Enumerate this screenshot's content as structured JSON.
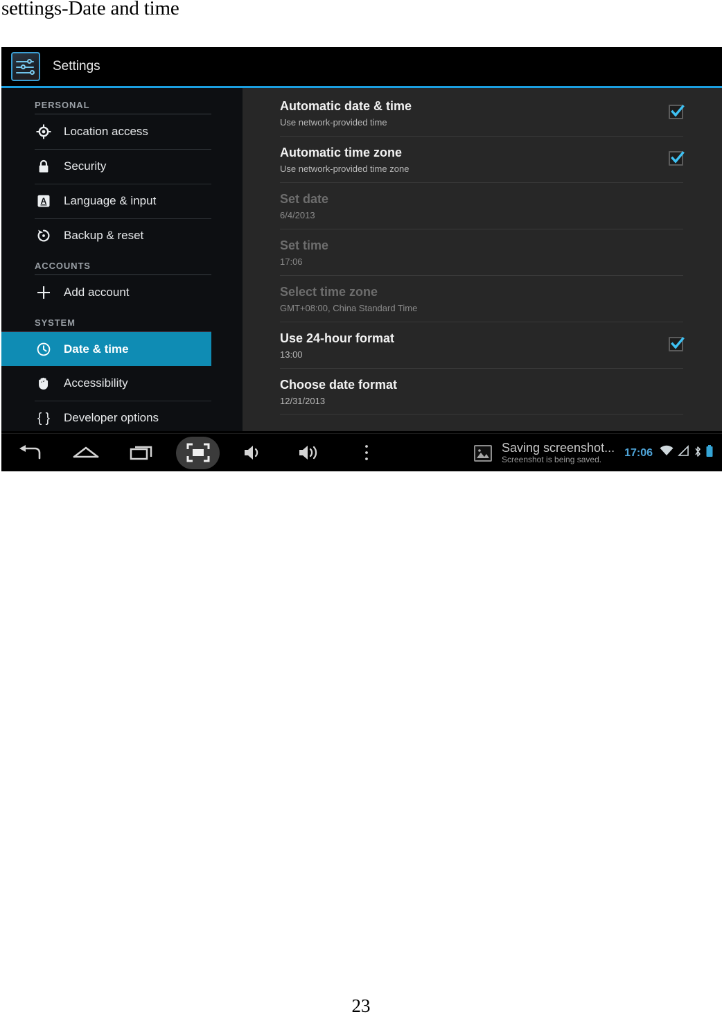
{
  "document": {
    "caption": "settings-Date and time",
    "page_number": "23"
  },
  "action_bar": {
    "title": "Settings",
    "icon": "settings-sliders-icon",
    "accent_color": "#1b9fe0"
  },
  "sidebar": {
    "groups": [
      {
        "header": "PERSONAL",
        "items": [
          {
            "label": "Location access",
            "icon": "location-crosshair-icon",
            "selected": false
          },
          {
            "label": "Security",
            "icon": "lock-icon",
            "selected": false
          },
          {
            "label": "Language & input",
            "icon": "language-a-icon",
            "selected": false
          },
          {
            "label": "Backup & reset",
            "icon": "restore-icon",
            "selected": false
          }
        ]
      },
      {
        "header": "ACCOUNTS",
        "items": [
          {
            "label": "Add account",
            "icon": "plus-icon",
            "selected": false
          }
        ]
      },
      {
        "header": "SYSTEM",
        "items": [
          {
            "label": "Date & time",
            "icon": "clock-icon",
            "selected": true
          },
          {
            "label": "Accessibility",
            "icon": "hand-icon",
            "selected": false
          },
          {
            "label": "Developer options",
            "icon": "curly-braces-icon",
            "selected": false
          }
        ]
      }
    ],
    "selected_color": "#0f8cb4"
  },
  "main": {
    "rows": [
      {
        "title": "Automatic date & time",
        "subtitle": "Use network-provided time",
        "checkbox": true,
        "checked": true,
        "disabled": false
      },
      {
        "title": "Automatic time zone",
        "subtitle": "Use network-provided time zone",
        "checkbox": true,
        "checked": true,
        "disabled": false
      },
      {
        "title": "Set date",
        "subtitle": "6/4/2013",
        "checkbox": false,
        "checked": false,
        "disabled": true
      },
      {
        "title": "Set time",
        "subtitle": "17:06",
        "checkbox": false,
        "checked": false,
        "disabled": true
      },
      {
        "title": "Select time zone",
        "subtitle": "GMT+08:00, China Standard Time",
        "checkbox": false,
        "checked": false,
        "disabled": true
      },
      {
        "title": "Use 24-hour format",
        "subtitle": "13:00",
        "checkbox": true,
        "checked": true,
        "disabled": false
      },
      {
        "title": "Choose date format",
        "subtitle": "12/31/2013",
        "checkbox": false,
        "checked": false,
        "disabled": false
      }
    ],
    "checkbox_check_color": "#3ec1f3"
  },
  "navbar": {
    "buttons": [
      {
        "name": "back-icon",
        "active": false
      },
      {
        "name": "home-icon",
        "active": false
      },
      {
        "name": "recents-icon",
        "active": false
      },
      {
        "name": "screenshot-icon",
        "active": true
      },
      {
        "name": "volume-down-icon",
        "active": false
      },
      {
        "name": "volume-up-icon",
        "active": false
      },
      {
        "name": "overflow-menu-icon",
        "active": false
      }
    ]
  },
  "status": {
    "notification": {
      "icon": "image-icon",
      "title": "Saving screenshot...",
      "subtitle": "Screenshot is being saved."
    },
    "clock": "17:06",
    "clock_color": "#4ea4d8",
    "icons": [
      "wifi-icon",
      "signal-icon",
      "bluetooth-icon",
      "battery-icon"
    ],
    "battery_color": "#35a5d6"
  }
}
